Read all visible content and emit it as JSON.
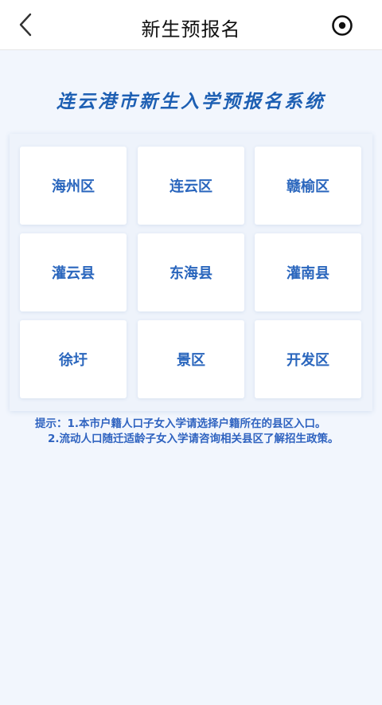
{
  "nav": {
    "title": "新生预报名",
    "back_icon": "chevron-left-icon",
    "more_icon": "target-icon"
  },
  "heading": "连云港市新生入学预报名系统",
  "districts": [
    "海州区",
    "连云区",
    "赣榆区",
    "灌云县",
    "东海县",
    "灌南县",
    "徐圩",
    "景区",
    "开发区"
  ],
  "tips": {
    "line1": "提示：1.本市户籍人口子女入学请选择户籍所在的县区入口。",
    "line2": "2.流动人口随迁适龄子女入学请咨询相关县区了解招生政策。"
  },
  "colors": {
    "accent": "#2a66bd",
    "heading": "#1d5fb3",
    "background": "#f2f6fd"
  }
}
